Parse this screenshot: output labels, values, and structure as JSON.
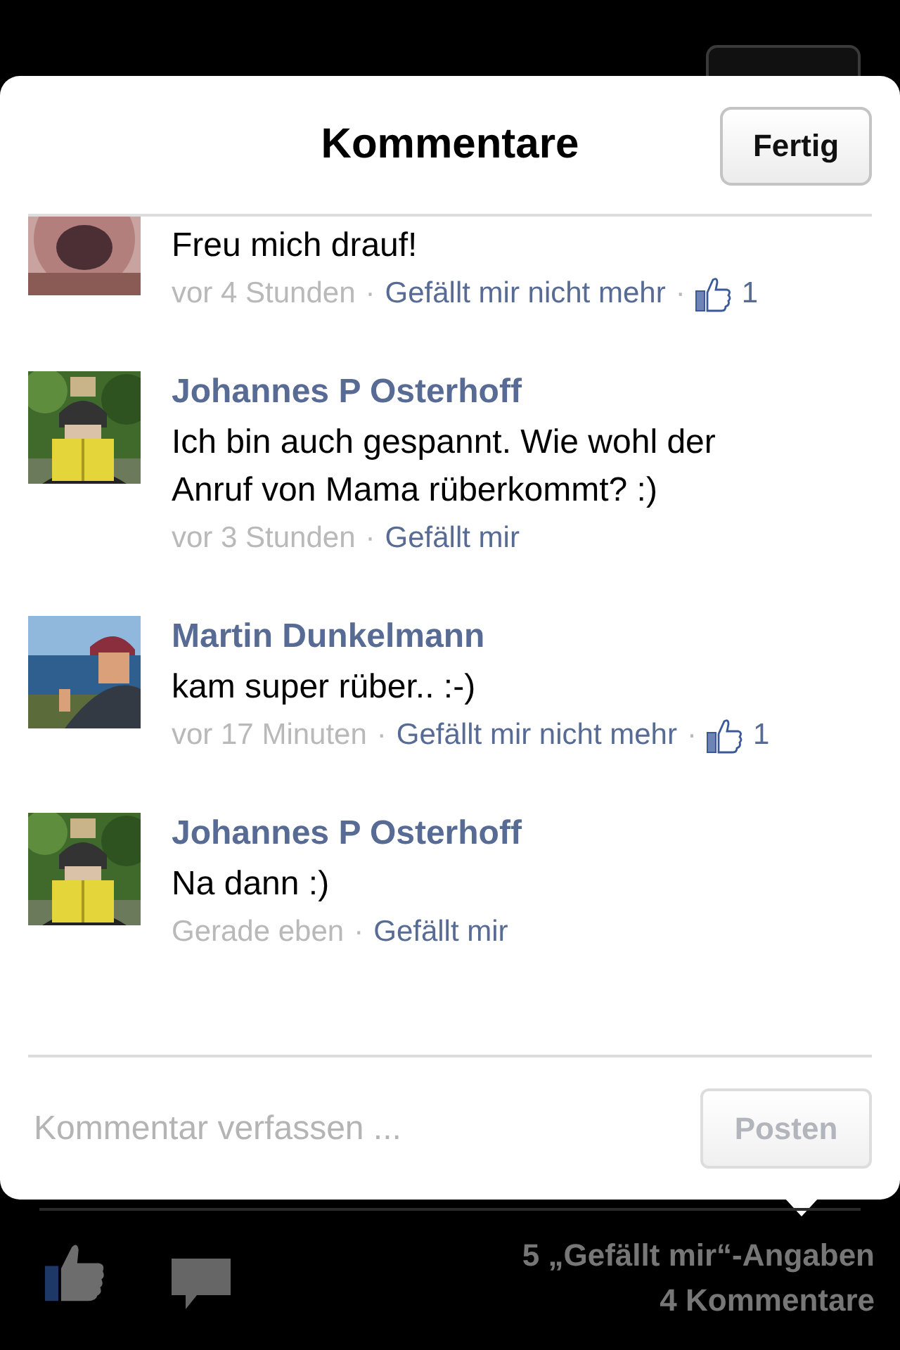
{
  "dialog": {
    "title": "Kommentare",
    "done_button": "Fertig",
    "meta_separator": "·"
  },
  "comments": [
    {
      "text": "Freu mich drauf!",
      "time": "vor 4 Stunden",
      "like_action": "Gefällt mir nicht mehr",
      "likes": "1"
    },
    {
      "author": "Johannes P Osterhoff",
      "text": "Ich bin auch gespannt. Wie wohl der Anruf von Mama rüberkommt? :)",
      "time": "vor 3 Stunden",
      "like_action": "Gefällt mir"
    },
    {
      "author": "Martin Dunkelmann",
      "text": "kam super rüber.. :-)",
      "time": "vor 17 Minuten",
      "like_action": "Gefällt mir nicht mehr",
      "likes": "1"
    },
    {
      "author": "Johannes P Osterhoff",
      "text": "Na dann :)",
      "time": "Gerade eben",
      "like_action": "Gefällt mir"
    }
  ],
  "composer": {
    "placeholder": "Kommentar verfassen ...",
    "button": "Posten",
    "button_disabled": true
  },
  "footer": {
    "like_count": "5 „Gefällt mir“-Angaben",
    "comment_count": "4 Kommentare"
  }
}
